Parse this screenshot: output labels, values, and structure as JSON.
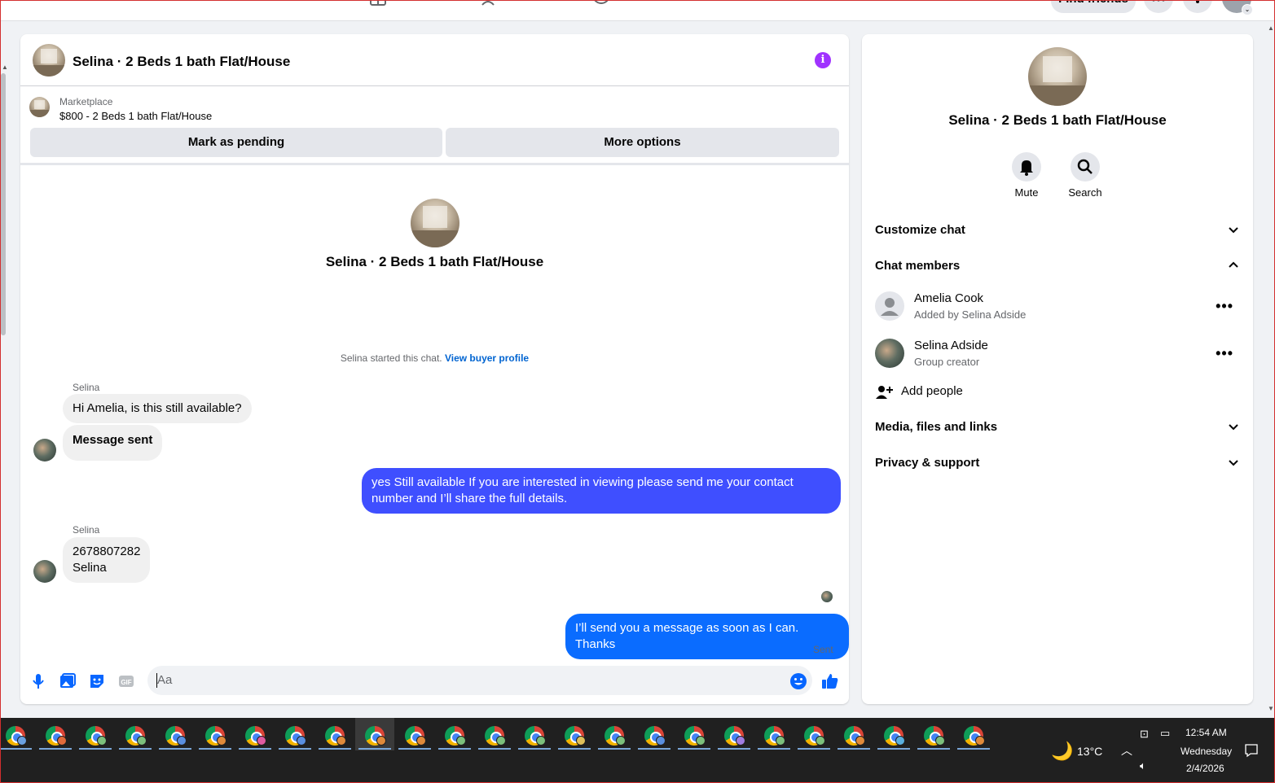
{
  "topnav": {
    "find_friends": "Find friends"
  },
  "chat": {
    "title": "Selina · 2 Beds 1 bath Flat/House",
    "marketplace_label": "Marketplace",
    "marketplace_item": "$800 - 2 Beds 1 bath Flat/House",
    "mark_pending": "Mark as pending",
    "more_options": "More options",
    "center_name": "Selina · 2 Beds 1 bath Flat/House",
    "started_text": "Selina started this chat. ",
    "view_buyer": "View buyer profile",
    "messages": [
      {
        "sender": "Selina",
        "text": "Hi Amelia, is this still available?"
      },
      {
        "text": "Message sent"
      },
      {
        "text": "yes Still available If you are interested in viewing please send me your contact number and I’ll share the full details."
      },
      {
        "sender": "Selina",
        "line1": "2678807282",
        "line2": "Selina"
      },
      {
        "text": "I’ll send you a message as soon as I can. Thanks"
      }
    ],
    "sent_status": "Sent",
    "composer_placeholder": "Aa",
    "colors": {
      "outgoing_1": "#3f4fff",
      "outgoing_2": "#0a6cff",
      "accent": "#0866ff"
    }
  },
  "details": {
    "name": "Selina · 2 Beds 1 bath Flat/House",
    "mute": "Mute",
    "search": "Search",
    "customize_chat": "Customize chat",
    "chat_members": "Chat members",
    "members": [
      {
        "name": "Amelia Cook",
        "sub": "Added by Selina Adside"
      },
      {
        "name": "Selina Adside",
        "sub": "Group creator"
      }
    ],
    "add_people": "Add people",
    "media": "Media, files and links",
    "privacy": "Privacy & support"
  },
  "taskbar": {
    "weather": "13°C",
    "time": "12:54 AM",
    "day": "Wednesday",
    "date": "2/4/2026",
    "profile_colors": [
      "#6aa0e0",
      "#e06a3a",
      "#7cc07c",
      "#7cc07c",
      "#5a8fe0",
      "#e08a3a",
      "#e05aa0",
      "#5a8fe0",
      "#e08a3a",
      "#e08a3a",
      "#e08a3a",
      "#7cc07c",
      "#7cc07c",
      "#7cc07c",
      "#e0c05a",
      "#7cc07c",
      "#5a8fe0",
      "#7cc07c",
      "#a07ce0",
      "#7cc07c",
      "#7cc07c",
      "#e08a3a",
      "#5ab0e0",
      "#7cc07c",
      "#e08a3a"
    ]
  }
}
